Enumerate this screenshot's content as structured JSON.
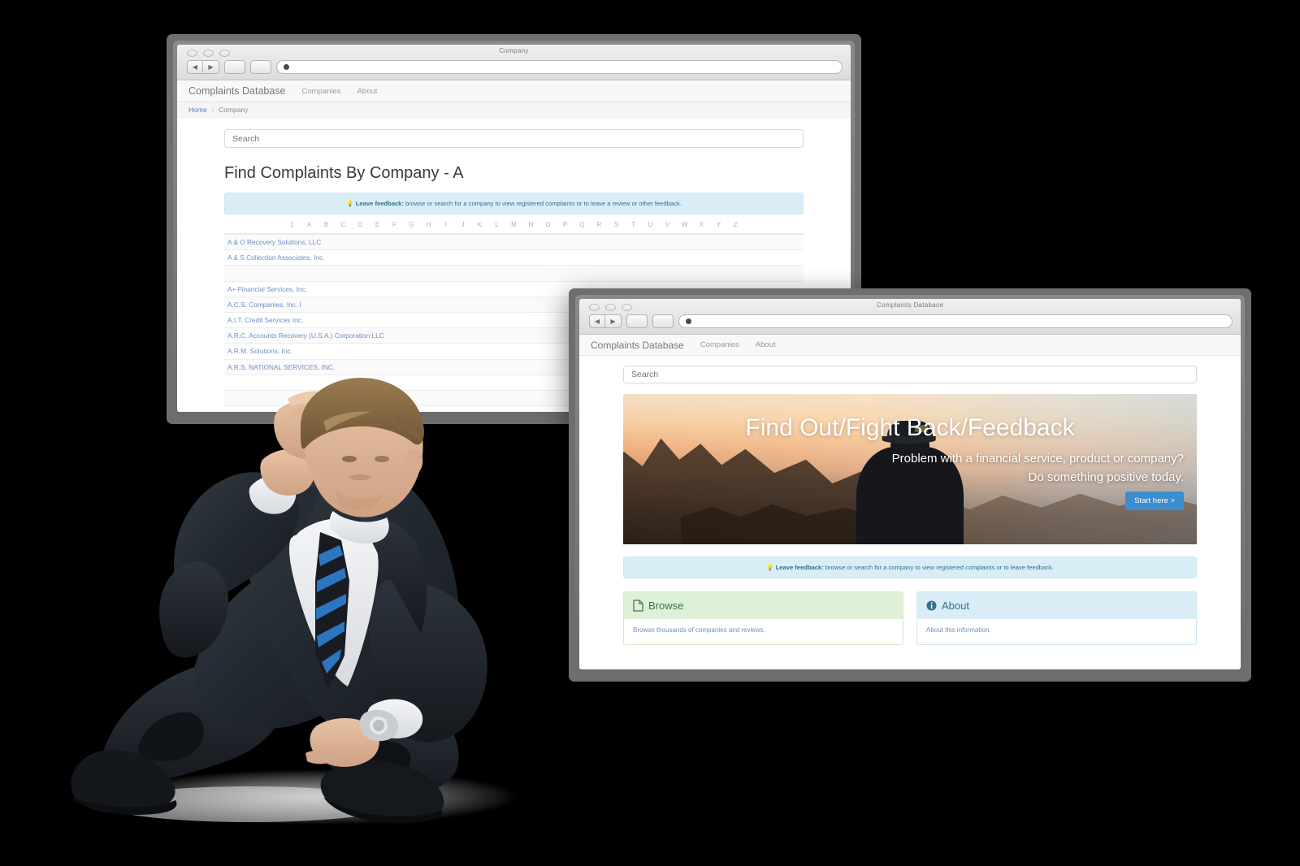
{
  "colors": {
    "accent_blue": "#3c8dcd",
    "link_blue": "#6d8fc4",
    "info_bg": "#d9edf7",
    "info_text": "#31708f",
    "success_bg": "#dff0d8",
    "success_text": "#3c763d",
    "nav_bg": "#f8f8f8",
    "window_chrome": "#6e6e6e",
    "page_bg": "#000000"
  },
  "window1": {
    "title": "Company",
    "url": "",
    "nav": {
      "brand": "Complaints Database",
      "links": [
        {
          "label": "Companies",
          "name": "nav-link-companies"
        },
        {
          "label": "About",
          "name": "nav-link-about"
        }
      ]
    },
    "breadcrumb": {
      "home": "Home",
      "separator": "/",
      "current": "Company"
    },
    "search": {
      "placeholder": "Search",
      "value": ""
    },
    "heading": "Find Complaints By Company - A",
    "alert": {
      "icon": "lightbulb-icon",
      "bold": "Leave feedback:",
      "text": " browse or search for a company to view registered complaints or to leave a review or other feedback."
    },
    "alpha_nav": [
      "1",
      "A",
      "B",
      "C",
      "D",
      "E",
      "F",
      "G",
      "H",
      "I",
      "J",
      "K",
      "L",
      "M",
      "N",
      "O",
      "P",
      "Q",
      "R",
      "S",
      "T",
      "U",
      "V",
      "W",
      "X",
      "Y",
      "Z"
    ],
    "companies": [
      "A & O Recovery Solutions, LLC",
      "A & S Collection Associates, Inc.",
      "",
      "A+ Financial Services, Inc.",
      "A.C.S. Companies, Inc. I",
      "A.I.T. Credit Services Inc.",
      "A.R.C. Accounts Recovery (U.S.A.) Corporation LLC",
      "A.R.M. Solutions, Inc.",
      "A.R.S. NATIONAL SERVICES, INC.",
      "",
      ""
    ],
    "chrome": {
      "back_icon": "back-arrow-icon",
      "forward_icon": "forward-arrow-icon",
      "favicon": "globe-icon"
    }
  },
  "window2": {
    "title": "Complaints Database",
    "url": "",
    "nav": {
      "brand": "Complaints Database",
      "links": [
        {
          "label": "Companies",
          "name": "nav-link-companies"
        },
        {
          "label": "About",
          "name": "nav-link-about"
        }
      ]
    },
    "search": {
      "placeholder": "Search",
      "value": ""
    },
    "hero": {
      "headline": "Find Out/Fight Back/Feedback",
      "subline1": "Problem with a financial service, product or company?",
      "subline2": "Do something positive today.",
      "cta_label": "Start here >",
      "image_alt": "person-on-mountain-at-sunset"
    },
    "alert": {
      "icon": "lightbulb-icon",
      "bold": "Leave feedback:",
      "text": " browse or search for a company to view registered complaints or to leave feedback."
    },
    "panels": [
      {
        "name": "panel-browse",
        "icon": "file-icon",
        "title": "Browse",
        "body": "Browse thousands of companies and reviews.",
        "style": "success"
      },
      {
        "name": "panel-about",
        "icon": "info-circle-icon",
        "title": "About",
        "body": "About this information.",
        "style": "info"
      }
    ],
    "chrome": {
      "back_icon": "back-arrow-icon",
      "forward_icon": "forward-arrow-icon",
      "favicon": "globe-icon"
    }
  },
  "photo": {
    "name": "frustrated-businessman-photo",
    "description": "Man in dark suit sitting on floor with hand on head"
  }
}
